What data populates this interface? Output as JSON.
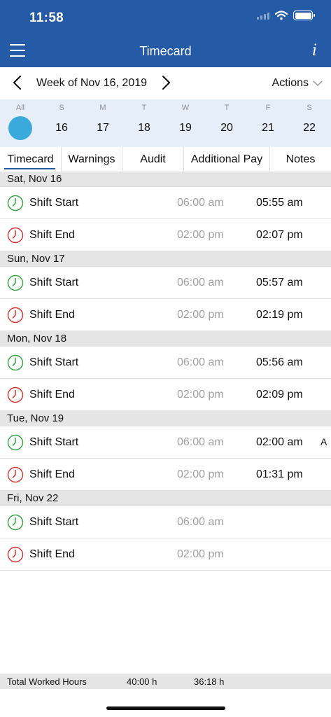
{
  "status_bar": {
    "time": "11:58"
  },
  "nav": {
    "title": "Timecard",
    "info_label": "i",
    "menu_icon": "hamburger-icon",
    "info_icon": "info-icon"
  },
  "week": {
    "label": "Week of Nov 16, 2019",
    "actions_label": "Actions"
  },
  "days": [
    {
      "letter": "All",
      "number": "",
      "selected": true
    },
    {
      "letter": "S",
      "number": "16"
    },
    {
      "letter": "M",
      "number": "17"
    },
    {
      "letter": "T",
      "number": "18"
    },
    {
      "letter": "W",
      "number": "19"
    },
    {
      "letter": "T",
      "number": "20"
    },
    {
      "letter": "F",
      "number": "21"
    },
    {
      "letter": "S",
      "number": "22"
    }
  ],
  "tabs": [
    "Timecard",
    "Warnings",
    "Audit",
    "Additional Pay",
    "Notes"
  ],
  "active_tab": "Timecard",
  "colors": {
    "brand": "#245aa6",
    "selected_day": "#3aa9dc",
    "start_icon": "#2fa53a",
    "end_icon": "#d9302c"
  },
  "entries": [
    {
      "date": "Sat, Nov 16",
      "rows": [
        {
          "type": "start",
          "label": "Shift Start",
          "scheduled": "06:00 am",
          "actual": "05:55 am",
          "flag": ""
        },
        {
          "type": "end",
          "label": "Shift End",
          "scheduled": "02:00 pm",
          "actual": "02:07 pm",
          "flag": ""
        }
      ]
    },
    {
      "date": "Sun, Nov 17",
      "rows": [
        {
          "type": "start",
          "label": "Shift Start",
          "scheduled": "06:00 am",
          "actual": "05:57 am",
          "flag": ""
        },
        {
          "type": "end",
          "label": "Shift End",
          "scheduled": "02:00 pm",
          "actual": "02:19 pm",
          "flag": ""
        }
      ]
    },
    {
      "date": "Mon, Nov 18",
      "rows": [
        {
          "type": "start",
          "label": "Shift Start",
          "scheduled": "06:00 am",
          "actual": "05:56 am",
          "flag": ""
        },
        {
          "type": "end",
          "label": "Shift End",
          "scheduled": "02:00 pm",
          "actual": "02:09 pm",
          "flag": ""
        }
      ]
    },
    {
      "date": "Tue, Nov 19",
      "rows": [
        {
          "type": "start",
          "label": "Shift Start",
          "scheduled": "06:00 am",
          "actual": "02:00 am",
          "flag": "A"
        },
        {
          "type": "end",
          "label": "Shift End",
          "scheduled": "02:00 pm",
          "actual": "01:31 pm",
          "flag": ""
        }
      ]
    },
    {
      "date": "Fri, Nov 22",
      "rows": [
        {
          "type": "start",
          "label": "Shift Start",
          "scheduled": "06:00 am",
          "actual": "",
          "flag": ""
        },
        {
          "type": "end",
          "label": "Shift End",
          "scheduled": "02:00 pm",
          "actual": "",
          "flag": ""
        }
      ]
    }
  ],
  "footer": {
    "label": "Total Worked Hours",
    "scheduled_total": "40:00 h",
    "actual_total": "36:18 h"
  }
}
